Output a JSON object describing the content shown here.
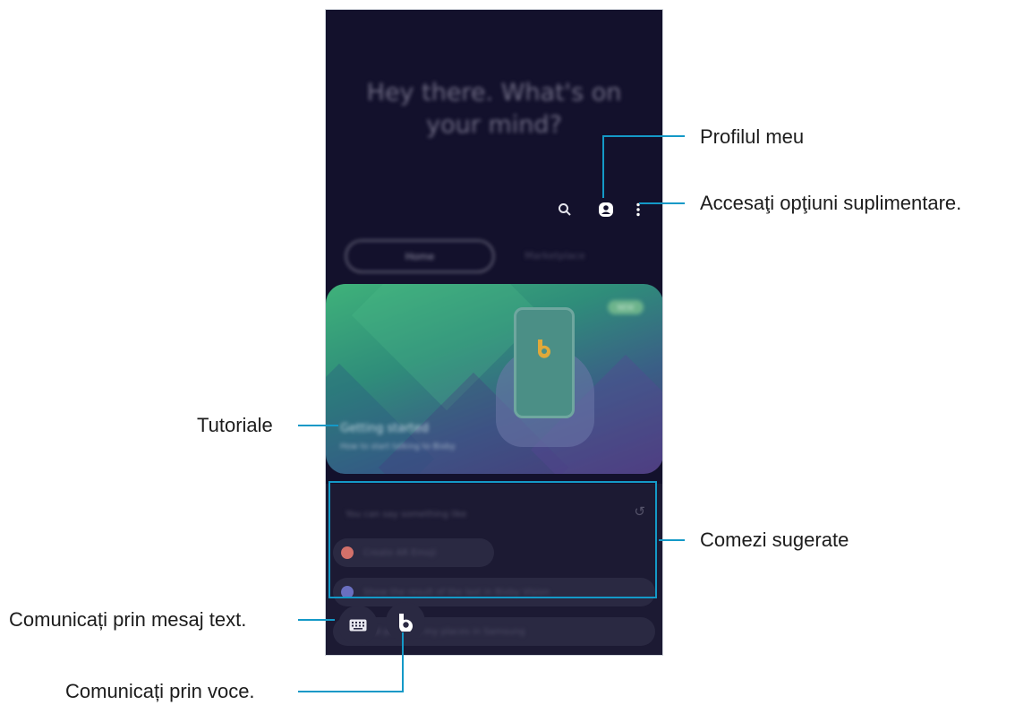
{
  "screen": {
    "greeting": "Hey there. What's on your mind?",
    "tabs": [
      "Home",
      "Marketplace"
    ],
    "banner": {
      "badge": "NEW",
      "title": "Getting started",
      "subtitle": "How to start talking to Bixby"
    },
    "suggestions": {
      "title": "You can say something like",
      "items": [
        "Create AR Emoji",
        "Show the result of the last in Bixby Vision",
        "Add photo to my places in Samsung"
      ]
    }
  },
  "callouts": {
    "profile": "Profilul meu",
    "more_options": "Accesaţi opţiuni suplimentare.",
    "tutorials": "Tutoriale",
    "suggested_commands": "Comezi sugerate",
    "text_input": "Comunicați prin mesaj text.",
    "voice_input": "Comunicați prin voce."
  },
  "colors": {
    "accent": "#1499c7",
    "screen_bg": "#13112c"
  }
}
